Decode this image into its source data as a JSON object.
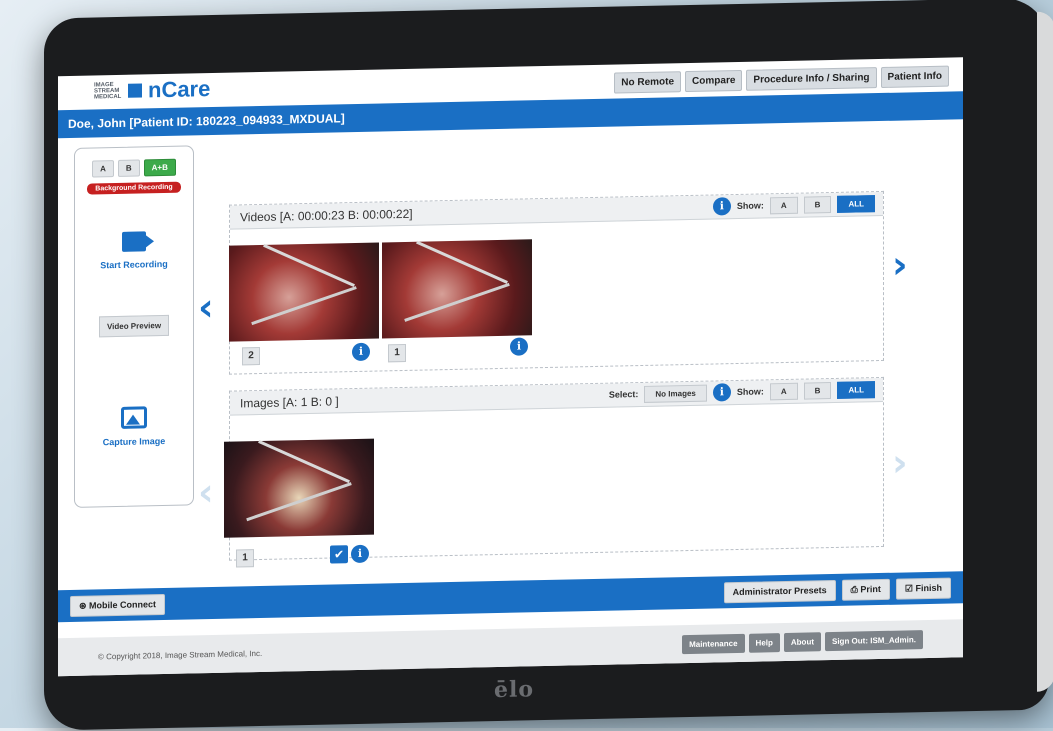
{
  "app": {
    "logo_small": "IMAGE STREAM MEDICAL",
    "title": "nCare"
  },
  "header": {
    "tabs": [
      "No Remote",
      "Compare",
      "Procedure Info / Sharing",
      "Patient Info"
    ]
  },
  "patient": {
    "label": "Doe, John [Patient ID: 180223_094933_MXDUAL]"
  },
  "left_panel": {
    "channel_buttons": [
      "A",
      "B",
      "A+B"
    ],
    "background_recording": "Background Recording",
    "start_recording": "Start Recording",
    "video_preview": "Video Preview",
    "capture_image": "Capture Image"
  },
  "videos": {
    "title": "Videos [A: 00:00:23   B: 00:00:22]",
    "show_label": "Show:",
    "filters": [
      "A",
      "B",
      "ALL"
    ],
    "selected_filter": "ALL",
    "items": [
      {
        "number": "2"
      },
      {
        "number": "1"
      }
    ]
  },
  "images": {
    "title": "Images [A: 1   B: 0 ]",
    "select_label": "Select:",
    "select_value": "No Images",
    "show_label": "Show:",
    "filters": [
      "A",
      "B",
      "ALL"
    ],
    "selected_filter": "ALL",
    "items": [
      {
        "number": "1",
        "checked": true
      }
    ]
  },
  "bottom_bar": {
    "mobile_connect": "Mobile Connect",
    "administrator_presets": "Administrator Presets",
    "print": "Print",
    "finish": "Finish"
  },
  "footer": {
    "copyright": "© Copyright 2018, Image Stream Medical, Inc.",
    "buttons": [
      "Maintenance",
      "Help",
      "About",
      "Sign Out: ISM_Admin."
    ]
  },
  "brand": "ēlo",
  "colors": {
    "accent": "#1a6fc4",
    "recording": "#c62020",
    "active_green": "#3caa4a"
  }
}
